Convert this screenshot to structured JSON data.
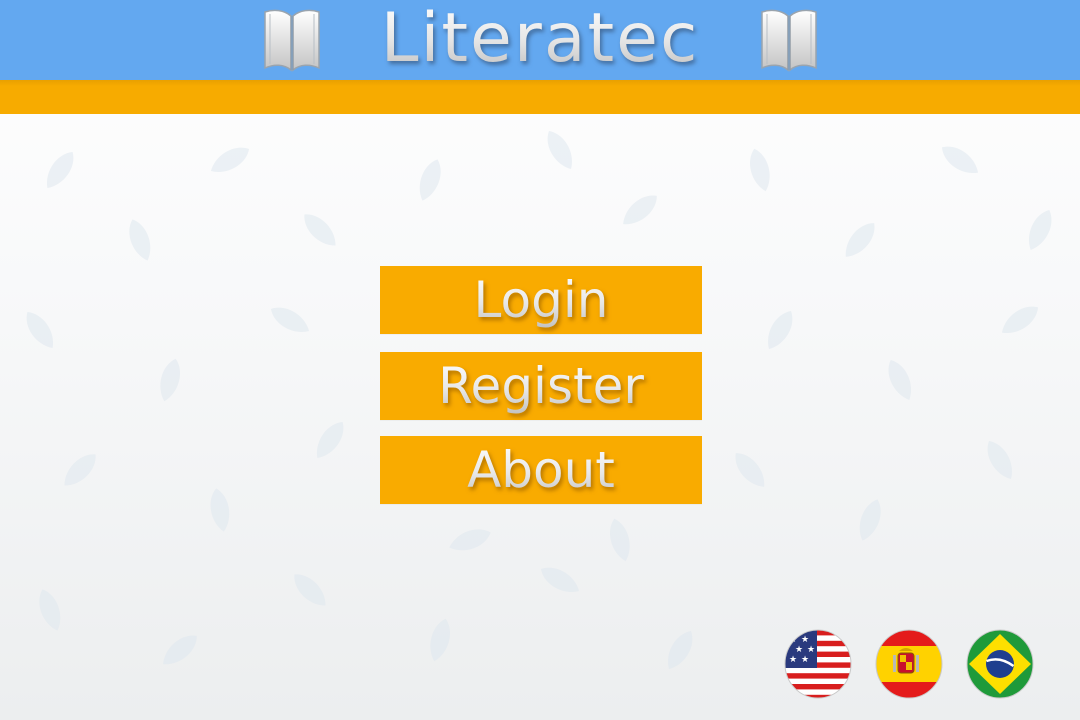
{
  "header": {
    "title": "Literatec",
    "left_icon": "open-book-icon",
    "right_icon": "open-book-icon"
  },
  "menu": {
    "login_label": "Login",
    "register_label": "Register",
    "about_label": "About"
  },
  "languages": [
    {
      "name": "english",
      "icon": "us-flag-icon"
    },
    {
      "name": "spanish",
      "icon": "spain-flag-icon"
    },
    {
      "name": "portuguese",
      "icon": "brazil-flag-icon"
    }
  ],
  "colors": {
    "header_blue": "#63a8f0",
    "accent_orange": "#f9ab00",
    "background": "#f4f5f6",
    "title_text": "#eaeaea"
  }
}
